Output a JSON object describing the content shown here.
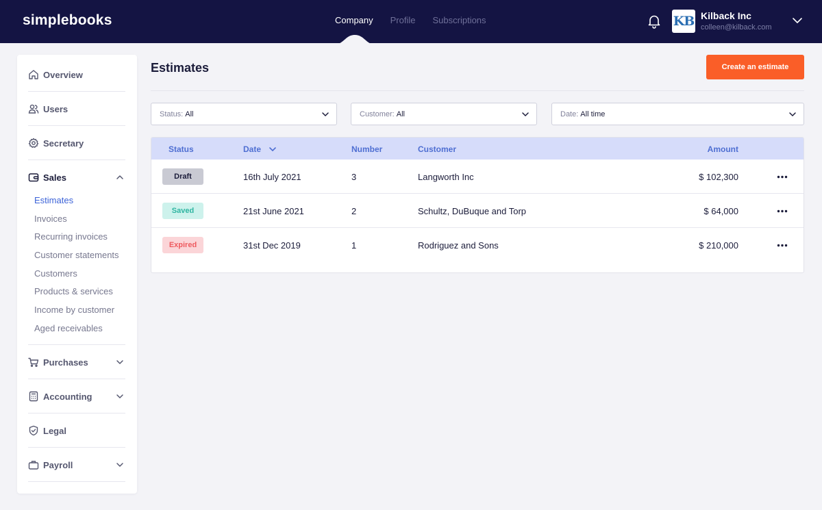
{
  "app": {
    "logo": "simplebooks"
  },
  "topnav": [
    {
      "label": "Company",
      "active": true
    },
    {
      "label": "Profile",
      "active": false
    },
    {
      "label": "Subscriptions",
      "active": false
    }
  ],
  "account": {
    "logo_text": "KB",
    "company": "Kilback Inc",
    "email": "colleen@kilback.com",
    "icons": {
      "notifications": "bell-icon",
      "menu": "chevron-down-icon"
    }
  },
  "sidebar": {
    "items": [
      {
        "label": "Overview",
        "icon": "home-icon"
      },
      {
        "label": "Users",
        "icon": "users-icon"
      },
      {
        "label": "Secretary",
        "icon": "gear-icon"
      },
      {
        "label": "Sales",
        "icon": "wallet-icon",
        "expanded": true
      },
      {
        "label": "Purchases",
        "icon": "cart-icon"
      },
      {
        "label": "Accounting",
        "icon": "calculator-icon"
      },
      {
        "label": "Legal",
        "icon": "shield-icon"
      },
      {
        "label": "Payroll",
        "icon": "briefcase-icon"
      }
    ],
    "sales_sub": [
      {
        "label": "Estimates",
        "active": true
      },
      {
        "label": "Invoices"
      },
      {
        "label": "Recurring invoices"
      },
      {
        "label": "Customer statements"
      },
      {
        "label": "Customers"
      },
      {
        "label": "Products & services"
      },
      {
        "label": "Income by customer"
      },
      {
        "label": "Aged receivables"
      }
    ]
  },
  "main": {
    "title": "Estimates",
    "create_button": "Create an estimate",
    "filters": [
      {
        "label": "Status:",
        "value": "All"
      },
      {
        "label": "Customer:",
        "value": "All"
      },
      {
        "label": "Date:",
        "value": "All time"
      }
    ]
  },
  "table": {
    "columns": {
      "status": "Status",
      "date": "Date",
      "number": "Number",
      "customer": "Customer",
      "amount": "Amount"
    },
    "rows": [
      {
        "status": "Draft",
        "date": "16th July 2021",
        "number": "3",
        "customer": "Langworth Inc",
        "amount": "$ 102,300"
      },
      {
        "status": "Saved",
        "date": "21st June 2021",
        "number": "2",
        "customer": "Schultz, DuBuque and Torp",
        "amount": "$ 64,000"
      },
      {
        "status": "Expired",
        "date": "31st Dec 2019",
        "number": "1",
        "customer": "Rodriguez and Sons",
        "amount": "$ 210,000"
      }
    ]
  },
  "colors": {
    "topbar": "#141443",
    "accent": "#fa5e28",
    "link": "#3c63d8",
    "table_header_bg": "#d6dcfa",
    "badge_draft": "#c9cad3",
    "badge_saved": "#cdf2ec",
    "badge_expired": "#fbd5d8"
  }
}
